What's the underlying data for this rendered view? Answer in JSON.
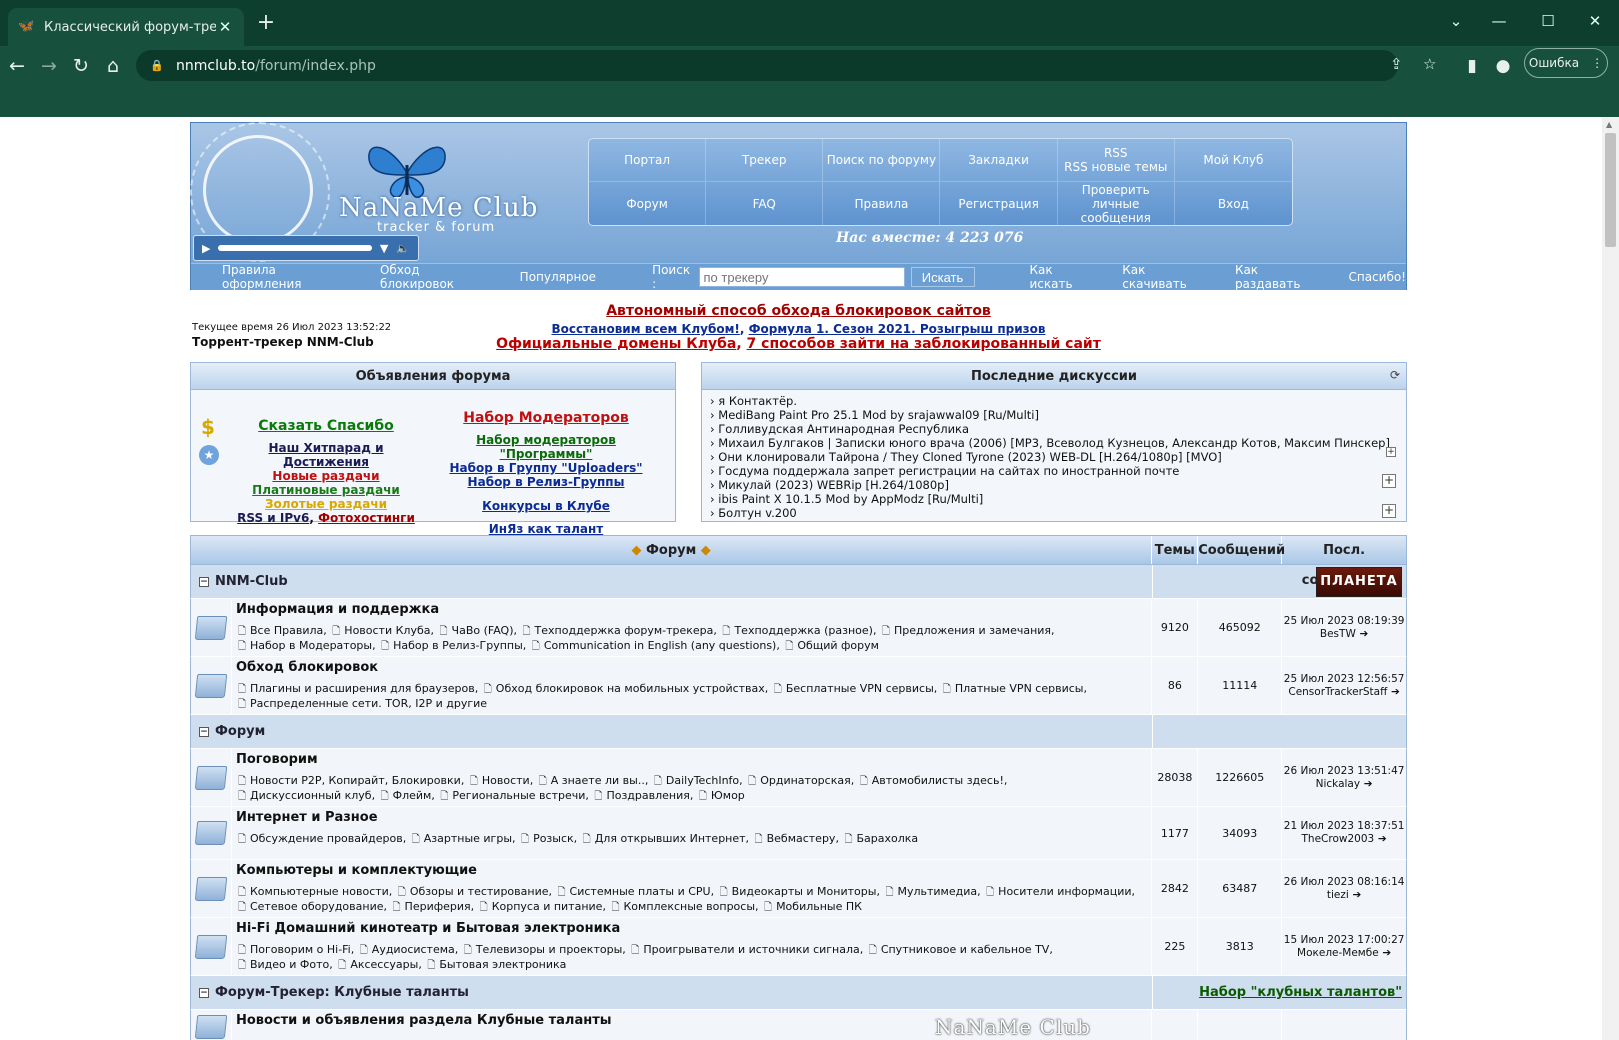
{
  "browser": {
    "tab_title": "Классический форум-трекер :: I",
    "url_domain": "nnmclub.to",
    "url_path": "/forum/index.php",
    "error_label": "Ошибка"
  },
  "header": {
    "logo": "NaNaMe Club",
    "logo_sub": "tracker & forum",
    "menu": [
      "Портал",
      "Трекер",
      "Поиск по форуму",
      "Закладки",
      "RSS\nRSS новые темы",
      "Мой Клуб",
      "Форум",
      "FAQ",
      "Правила",
      "Регистрация",
      "Проверить личные сообщения",
      "Вход"
    ],
    "together": "Нас вместе: 4 223 076",
    "toplinks": [
      "Правила оформления",
      "Обход блокировок",
      "Популярное"
    ],
    "search_label": "Поиск :",
    "search_placeholder": "по трекеру",
    "search_button": "Искать",
    "rightlinks": [
      "Как искать",
      "Как скачивать",
      "Как раздавать",
      "Спасибо!"
    ]
  },
  "notices": {
    "current_time": "Текущее время 26 Июл 2023 13:52:22",
    "tracker_title": "Торрент-трекер NNM-Club",
    "line1": "Автономный способ обхода блокировок сайтов",
    "line2a": "Восстановим всем Клубом!",
    "line2b": "Формула 1. Сезон 2021. Розыгрыш призов",
    "line3a": "Официальные домены Клуба",
    "line3b": "7 способов зайти на заблокированный сайт"
  },
  "announcements": {
    "title": "Объявления форума",
    "left": [
      {
        "text": "Сказать Спасибо",
        "color": "#0a7a0a",
        "size": "14px"
      },
      {
        "text": "Наш Хитпарад и Достижения",
        "color": "#1a1a55",
        "size": "12px"
      },
      {
        "text": "Новые раздачи",
        "color": "#c01010",
        "size": "12px"
      },
      {
        "text": "Платиновые раздачи",
        "color": "#1a7a1a",
        "size": "12px"
      },
      {
        "text": "Золотые раздачи",
        "color": "#d8a800",
        "size": "12px"
      },
      {
        "text": "RSS и IPv6",
        "color": "#1a1a55",
        "size": "12px"
      },
      {
        "text": "Фотохостинги",
        "color": "#a00000",
        "size": "12px"
      }
    ],
    "right": [
      {
        "text": "Набор Модераторов",
        "color": "#c01010",
        "size": "14px"
      },
      {
        "text": "Набор модераторов \"Программы\"",
        "color": "#0a6a0a",
        "size": "12px"
      },
      {
        "text": "Набор в Группу \"Uploaders\"",
        "color": "#0b2b95",
        "size": "12px"
      },
      {
        "text": "Набор в Релиз-Группы",
        "color": "#0b2b95",
        "size": "12px"
      },
      {
        "text": "Конкурсы в Клубе",
        "color": "#0b2b95",
        "size": "12px"
      },
      {
        "text": "ИнЯз как талант",
        "color": "#0b2b95",
        "size": "12px"
      }
    ]
  },
  "discussions": {
    "title": "Последние дискуссии",
    "items": [
      "я Контактёр.",
      "MediBang Paint Pro 25.1 Mod by srajawwal09 [Ru/Multi]",
      "Голливудская Антинародная Республика",
      "Михаил Булгаков | Записки юного врача (2006) [MP3, Всеволод Кузнецов, Александр Котов, Максим Пинскер]",
      "Они клонировали Тайрона / They Cloned Tyrone (2023) WEB-DL [H.264/1080p] [MVO]",
      "Госдума поддержала запрет регистрации на сайтах по иностранной почте",
      "Микулай (2023) WEBRip [H.264/1080p]",
      "ibis Paint X 10.1.5 Mod by AppModz [Ru/Multi]",
      "Болтун v.200"
    ]
  },
  "forum_table": {
    "header_forum": "Форум",
    "header_topics": "Темы",
    "header_posts": "Сообщений",
    "header_last": "Посл. сообщение",
    "planet_logo": "ПЛАНЕТА",
    "talents_link": "Набор \"клубных талантов\"",
    "categories": [
      {
        "name": "NNM-Club",
        "forums": [
          {
            "title": "Информация и поддержка",
            "subs": [
              "Все Правила",
              "Новости Клуба",
              "ЧаВо (FAQ)",
              "Техподдержка форум-трекера",
              "Техподдержка (разное)",
              "Предложения и замечания",
              "Набор в Модераторы",
              "Набор в Релиз-Группы",
              "Communication in English (any questions)",
              "Общий форум"
            ],
            "topics": "9120",
            "posts": "465092",
            "last_date": "25 Июл 2023 08:19:39",
            "last_user": "BesTW"
          },
          {
            "title": "Обход блокировок",
            "subs": [
              "Плагины и расширения для браузеров",
              "Обход блокировок на мобильных устройствах",
              "Бесплатные VPN сервисы",
              "Платные VPN сервисы",
              "Распределенные сети. TOR, I2P и другие"
            ],
            "topics": "86",
            "posts": "11114",
            "last_date": "25 Июл 2023 12:56:57",
            "last_user": "CensorTrackerStaff"
          }
        ]
      },
      {
        "name": "Форум",
        "forums": [
          {
            "title": "Поговорим",
            "subs": [
              "Новости P2P, Копирайт, Блокировки",
              "Новости",
              "А знаете ли вы..",
              "DailyTechInfo",
              "Ординаторская",
              "Автомобилисты здесь!",
              "Дискуссионный клуб",
              "Флейм",
              "Региональные встречи",
              "Поздравления",
              "Юмор"
            ],
            "topics": "28038",
            "posts": "1226605",
            "last_date": "26 Июл 2023 13:51:47",
            "last_user": "Nickalay"
          },
          {
            "title": "Интернет и Разное",
            "subs": [
              "Обсуждение провайдеров",
              "Азартные игры",
              "Розыск",
              "Для открывших Интернет",
              "Вебмастеру",
              "Барахолка"
            ],
            "topics": "1177",
            "posts": "34093",
            "last_date": "21 Июл 2023 18:37:51",
            "last_user": "TheCrow2003"
          },
          {
            "title": "Компьютеры и комплектующие",
            "subs": [
              "Компьютерные новости",
              "Обзоры и тестирование",
              "Системные платы и CPU",
              "Видеокарты и Мониторы",
              "Мультимедиа",
              "Носители информации",
              "Сетевое оборудование",
              "Периферия",
              "Корпуса и питание",
              "Комплексные вопросы",
              "Мобильные ПК"
            ],
            "topics": "2842",
            "posts": "63487",
            "last_date": "26 Июл 2023 08:16:14",
            "last_user": "tiezi"
          },
          {
            "title": "Hi-Fi Домашний кинотеатр и Бытовая электроника",
            "subs": [
              "Поговорим о Hi-Fi",
              "Аудиосистема",
              "Телевизоры и проекторы",
              "Проигрыватели и источники сигнала",
              "Спутниковое и кабельное TV",
              "Видео и Фото",
              "Аксессуары",
              "Бытовая электроника"
            ],
            "topics": "225",
            "posts": "3813",
            "last_date": "15 Июл 2023 17:00:27",
            "last_user": "Мокеле-Мембе"
          }
        ]
      },
      {
        "name": "Форум-Трекер: Клубные таланты",
        "forums": [
          {
            "title": "Новости и объявления раздела Клубные таланты",
            "subs": [],
            "topics": "",
            "posts": "",
            "last_date": "",
            "last_user": ""
          }
        ]
      }
    ]
  },
  "watermark": "NaNaMe Club"
}
